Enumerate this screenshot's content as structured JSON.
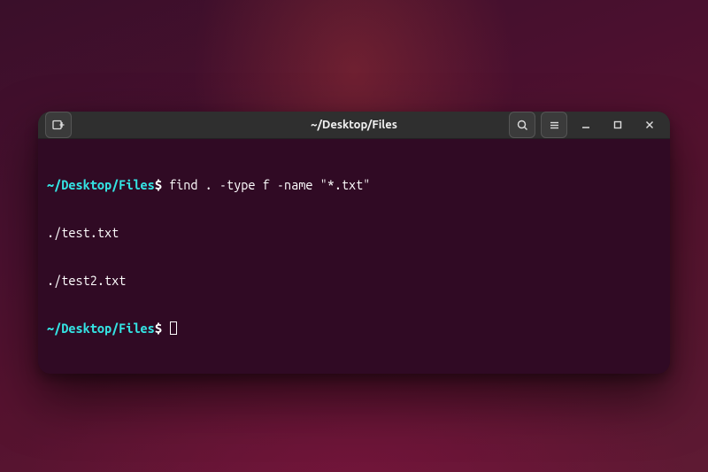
{
  "titlebar": {
    "title": "~/Desktop/Files",
    "icons": {
      "new_tab": "new-tab-icon",
      "search": "search-icon",
      "menu": "hamburger-menu-icon",
      "minimize": "minimize-icon",
      "maximize": "maximize-icon",
      "close": "close-icon"
    }
  },
  "terminal": {
    "prompt_path": "~/Desktop/Files",
    "prompt_separator": "$",
    "lines": [
      {
        "type": "cmd",
        "command": "find . -type f -name \"*.txt\""
      },
      {
        "type": "out",
        "text": "./test.txt"
      },
      {
        "type": "out",
        "text": "./test2.txt"
      },
      {
        "type": "cmd",
        "command": "",
        "cursor": true
      }
    ]
  },
  "colors": {
    "terminal_bg": "#300a24",
    "titlebar_bg": "#2f2f2f",
    "prompt_cyan": "#34e2e2",
    "text_white": "#ffffff"
  }
}
